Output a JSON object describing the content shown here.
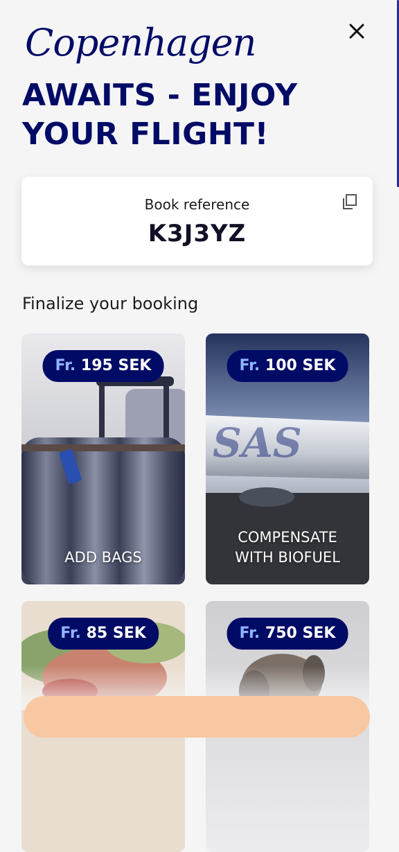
{
  "header": {
    "title_script": "Copenhagen",
    "title_bold": "AWAITS - ENJOY YOUR FLIGHT!",
    "close_icon": "close-icon"
  },
  "booking": {
    "label": "Book reference",
    "code": "K3J3YZ",
    "copy_icon": "copy-icon"
  },
  "section": {
    "title": "Finalize your booking"
  },
  "offers": [
    {
      "price_prefix": "Fr.",
      "price": "195 SEK",
      "label": "ADD BAGS"
    },
    {
      "price_prefix": "Fr.",
      "price": "100 SEK",
      "label": "COMPENSATE WITH BIOFUEL"
    },
    {
      "price_prefix": "Fr.",
      "price": "85 SEK",
      "label": ""
    },
    {
      "price_prefix": "Fr.",
      "price": "750 SEK",
      "label": ""
    }
  ],
  "colors": {
    "brand_navy": "#000b66",
    "price_prefix": "#8fb4ff",
    "cta_peach": "#f7c8a2",
    "background": "#f5f5f6"
  }
}
